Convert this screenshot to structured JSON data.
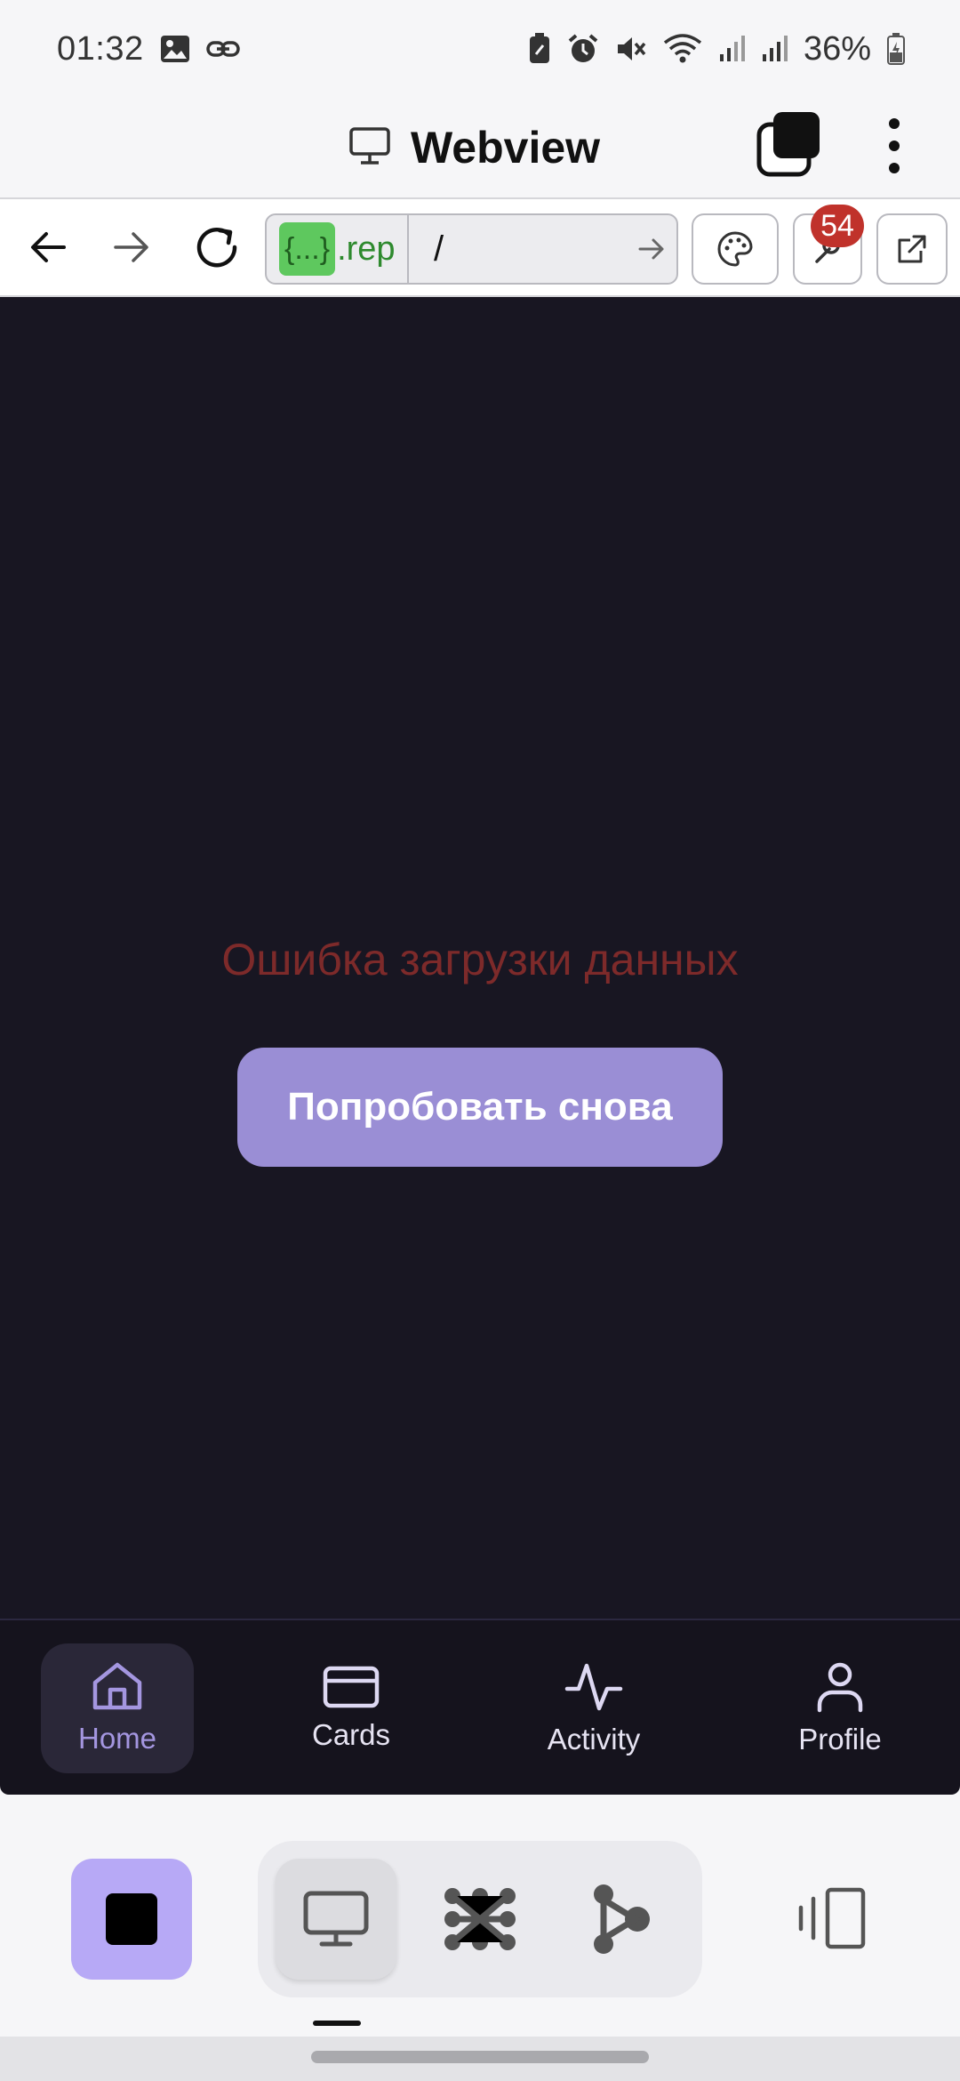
{
  "status_bar": {
    "time": "01:32",
    "battery": "36%"
  },
  "header": {
    "title": "Webview"
  },
  "toolbar": {
    "url_host_badge": "{...}",
    "url_host_suffix": ".rep",
    "url_path": "/",
    "notification_count": "54"
  },
  "content": {
    "error_message": "Ошибка загрузки данных",
    "retry_label": "Попробовать снова"
  },
  "bottom_nav": {
    "items": [
      {
        "label": "Home",
        "icon": "home-icon",
        "active": true
      },
      {
        "label": "Cards",
        "icon": "card-icon",
        "active": false
      },
      {
        "label": "Activity",
        "icon": "activity-icon",
        "active": false
      },
      {
        "label": "Profile",
        "icon": "profile-icon",
        "active": false
      }
    ]
  },
  "colors": {
    "content_bg": "#181622",
    "accent": "#9a8ed5",
    "error": "#7d2a2a",
    "badge": "#c0322b",
    "stop_button": "#b7a9f6",
    "url_badge": "#5ec85e"
  }
}
